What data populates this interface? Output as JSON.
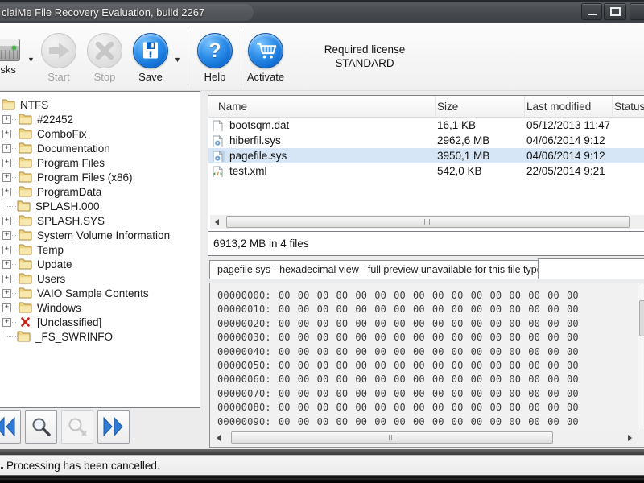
{
  "window": {
    "title": "claiMe File Recovery Evaluation, build 2267"
  },
  "toolbar": {
    "items": [
      {
        "label": "Disks",
        "icon": "disk-drive-icon",
        "enabled": true,
        "dropdown": true
      },
      {
        "label": "Start",
        "icon": "start-arrow-icon",
        "enabled": false,
        "dropdown": false
      },
      {
        "label": "Stop",
        "icon": "stop-x-icon",
        "enabled": false,
        "dropdown": false
      },
      {
        "label": "Save",
        "icon": "save-floppy-icon",
        "enabled": true,
        "dropdown": true
      },
      {
        "label": "Help",
        "icon": "help-question-icon",
        "enabled": true,
        "dropdown": false
      },
      {
        "label": "Activate",
        "icon": "shopping-cart-icon",
        "enabled": true,
        "dropdown": false
      }
    ],
    "license": {
      "line1": "Required license",
      "line2": "STANDARD"
    }
  },
  "tree": {
    "root": {
      "label": "NTFS",
      "icon": "folder-icon"
    },
    "items": [
      {
        "label": "#22452",
        "expandable": true,
        "icon": "folder-icon"
      },
      {
        "label": "ComboFix",
        "expandable": true,
        "icon": "folder-icon"
      },
      {
        "label": "Documentation",
        "expandable": true,
        "icon": "folder-icon"
      },
      {
        "label": "Program Files",
        "expandable": true,
        "icon": "folder-icon"
      },
      {
        "label": "Program Files (x86)",
        "expandable": true,
        "icon": "folder-icon"
      },
      {
        "label": "ProgramData",
        "expandable": true,
        "icon": "folder-icon"
      },
      {
        "label": "SPLASH.000",
        "expandable": false,
        "icon": "folder-icon"
      },
      {
        "label": "SPLASH.SYS",
        "expandable": true,
        "icon": "folder-icon"
      },
      {
        "label": "System Volume Information",
        "expandable": true,
        "icon": "folder-icon"
      },
      {
        "label": "Temp",
        "expandable": true,
        "icon": "folder-icon"
      },
      {
        "label": "Update",
        "expandable": true,
        "icon": "folder-icon"
      },
      {
        "label": "Users",
        "expandable": true,
        "icon": "folder-icon"
      },
      {
        "label": "VAIO Sample Contents",
        "expandable": true,
        "icon": "folder-icon"
      },
      {
        "label": "Windows",
        "expandable": true,
        "icon": "folder-icon"
      },
      {
        "label": "[Unclassified]",
        "expandable": true,
        "icon": "red-x-icon"
      },
      {
        "label": "_FS_SWRINFO",
        "expandable": false,
        "icon": "folder-icon"
      }
    ]
  },
  "file_list": {
    "columns": [
      "Name",
      "Size",
      "Last modified",
      "Status"
    ],
    "rows": [
      {
        "name": "bootsqm.dat",
        "size": "16,1 KB",
        "modified": "05/12/2013 11:47",
        "status": "",
        "icon": "file-icon",
        "selected": false
      },
      {
        "name": "hiberfil.sys",
        "size": "2962,6 MB",
        "modified": "04/06/2014 9:12",
        "status": "",
        "icon": "system-file-icon",
        "selected": false
      },
      {
        "name": "pagefile.sys",
        "size": "3950,1 MB",
        "modified": "04/06/2014 9:12",
        "status": "",
        "icon": "system-file-icon",
        "selected": true
      },
      {
        "name": "test.xml",
        "size": "542,0 KB",
        "modified": "22/05/2014 9:21",
        "status": "",
        "icon": "xml-file-icon",
        "selected": false
      }
    ],
    "summary": "6913,2 MB in 4 files"
  },
  "preview": {
    "tab_label": "pagefile.sys - hexadecimal view - full preview unavailable for this file type",
    "hex_rows": [
      {
        "offset": "00000000:",
        "bytes": "00 00 00 00 00 00 00 00 00 00 00 00 00 00 00 00"
      },
      {
        "offset": "00000010:",
        "bytes": "00 00 00 00 00 00 00 00 00 00 00 00 00 00 00 00"
      },
      {
        "offset": "00000020:",
        "bytes": "00 00 00 00 00 00 00 00 00 00 00 00 00 00 00 00"
      },
      {
        "offset": "00000030:",
        "bytes": "00 00 00 00 00 00 00 00 00 00 00 00 00 00 00 00"
      },
      {
        "offset": "00000040:",
        "bytes": "00 00 00 00 00 00 00 00 00 00 00 00 00 00 00 00"
      },
      {
        "offset": "00000050:",
        "bytes": "00 00 00 00 00 00 00 00 00 00 00 00 00 00 00 00"
      },
      {
        "offset": "00000060:",
        "bytes": "00 00 00 00 00 00 00 00 00 00 00 00 00 00 00 00"
      },
      {
        "offset": "00000070:",
        "bytes": "00 00 00 00 00 00 00 00 00 00 00 00 00 00 00 00"
      },
      {
        "offset": "00000080:",
        "bytes": "00 00 00 00 00 00 00 00 00 00 00 00 00 00 00 00"
      },
      {
        "offset": "00000090:",
        "bytes": "00 00 00 00 00 00 00 00 00 00 00 00 00 00 00 00"
      }
    ]
  },
  "nav": {
    "buttons": [
      {
        "name": "jump-previous-button",
        "icon": "double-left-arrow-icon",
        "enabled": true
      },
      {
        "name": "search-button",
        "icon": "magnifier-icon",
        "enabled": true
      },
      {
        "name": "search-cancel-button",
        "icon": "magnifier-cancel-icon",
        "enabled": false
      },
      {
        "name": "jump-next-button",
        "icon": "double-right-arrow-icon",
        "enabled": true
      }
    ]
  },
  "status_bar": {
    "text": "Processing has been cancelled."
  },
  "colors": {
    "titlebar_gray": "#46494d",
    "accent_blue": "#1581e6",
    "selection_blue": "#d7e6f6",
    "folder_yellow": "#edd384",
    "nav_arrow_blue": "#2e7cd6",
    "unclassified_red": "#c8251d"
  }
}
